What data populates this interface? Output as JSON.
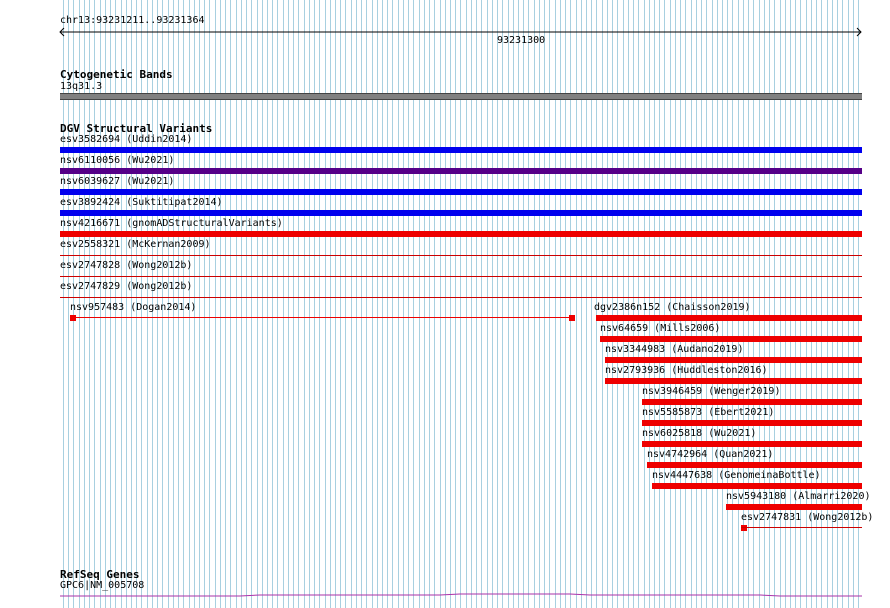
{
  "ruler": {
    "location": "chr13:93231211..93231364",
    "tick_label": "93231300"
  },
  "cytoband_track": {
    "title": "Cytogenetic Bands",
    "band": "13q31.3",
    "band_color": "#808080"
  },
  "dgv_track": {
    "title": "DGV Structural Variants",
    "full_width_features": [
      {
        "label": "esv3582694 (Uddin2014)",
        "color": "#0000ee",
        "style": "bar"
      },
      {
        "label": "nsv6110056 (Wu2021)",
        "color": "#550088",
        "style": "bar"
      },
      {
        "label": "nsv6039627 (Wu2021)",
        "color": "#0000ee",
        "style": "bar"
      },
      {
        "label": "esv3892424 (Suktitipat2014)",
        "color": "#0000ee",
        "style": "bar"
      },
      {
        "label": "nsv4216671 (gnomADStructuralVariants)",
        "color": "#ee0000",
        "style": "bar"
      },
      {
        "label": "esv2558321 (McKernan2009)",
        "color": "#cc0000",
        "style": "line"
      },
      {
        "label": "esv2747828 (Wong2012b)",
        "color": "#cc0000",
        "style": "line"
      },
      {
        "label": "esv2747829 (Wong2012b)",
        "color": "#cc0000",
        "style": "line"
      }
    ],
    "split_feature": {
      "label": "nsv957483 (Dogan2014)",
      "color": "#ee0000"
    },
    "partial_features": [
      {
        "label": "dgv2386n152 (Chaisson2019)",
        "color": "#ee0000"
      },
      {
        "label": "nsv64659 (Mills2006)",
        "color": "#ee0000"
      },
      {
        "label": "nsv3344983 (Audano2019)",
        "color": "#ee0000"
      },
      {
        "label": "nsv2793936 (Huddleston2016)",
        "color": "#ee0000"
      },
      {
        "label": "nsv3946459 (Wenger2019)",
        "color": "#ee0000"
      },
      {
        "label": "nsv5585873 (Ebert2021)",
        "color": "#ee0000"
      },
      {
        "label": "nsv6025818 (Wu2021)",
        "color": "#ee0000"
      },
      {
        "label": "nsv4742964 (Quan2021)",
        "color": "#ee0000"
      },
      {
        "label": "nsv4447638 (GenomeinaBottle)",
        "color": "#ee0000"
      },
      {
        "label": "nsv5943180 (Almarri2020)",
        "color": "#ee0000"
      },
      {
        "label": "esv2747831 (Wong2012b)",
        "color": "#ee0000"
      }
    ]
  },
  "refseq_track": {
    "title": "RefSeq Genes",
    "gene": "GPC6|NM_005708",
    "gene_color": "#aa33aa"
  },
  "colors": {
    "grid_line": "#a8d0e0",
    "background": "#ffffff"
  }
}
